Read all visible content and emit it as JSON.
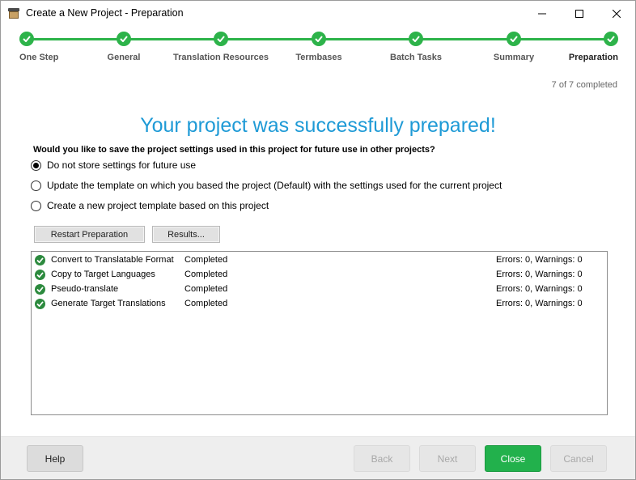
{
  "window": {
    "title": "Create a New Project - Preparation",
    "app_icon": "project-box-icon"
  },
  "stepper": {
    "steps": [
      {
        "label": "One Step",
        "completed": true
      },
      {
        "label": "General",
        "completed": true
      },
      {
        "label": "Translation Resources",
        "completed": true
      },
      {
        "label": "Termbases",
        "completed": true
      },
      {
        "label": "Batch Tasks",
        "completed": true
      },
      {
        "label": "Summary",
        "completed": true
      },
      {
        "label": "Preparation",
        "completed": true,
        "current": true
      }
    ],
    "progress_text": "7 of 7 completed",
    "accent_color": "#2db34a"
  },
  "main": {
    "headline": "Your project was successfully prepared!",
    "headline_color": "#1e9ad6",
    "question": "Would you like to save the project settings used in this project for future use in other projects?",
    "options": [
      {
        "label": "Do not store settings for future use",
        "selected": true
      },
      {
        "label": "Update the template on which you based the project (Default) with the settings used for the current project",
        "selected": false
      },
      {
        "label": "Create a new project template based on this project",
        "selected": false
      }
    ],
    "restart_label": "Restart Preparation",
    "results_label": "Results..."
  },
  "results": [
    {
      "name": "Convert to Translatable Format",
      "status": "Completed",
      "summary": "Errors: 0, Warnings: 0"
    },
    {
      "name": "Copy to Target Languages",
      "status": "Completed",
      "summary": "Errors: 0, Warnings: 0"
    },
    {
      "name": "Pseudo-translate",
      "status": "Completed",
      "summary": "Errors: 0, Warnings: 0"
    },
    {
      "name": "Generate Target Translations",
      "status": "Completed",
      "summary": "Errors: 0, Warnings: 0"
    }
  ],
  "footer": {
    "help": "Help",
    "back": "Back",
    "next": "Next",
    "close": "Close",
    "cancel": "Cancel",
    "primary_color": "#22b14c"
  }
}
